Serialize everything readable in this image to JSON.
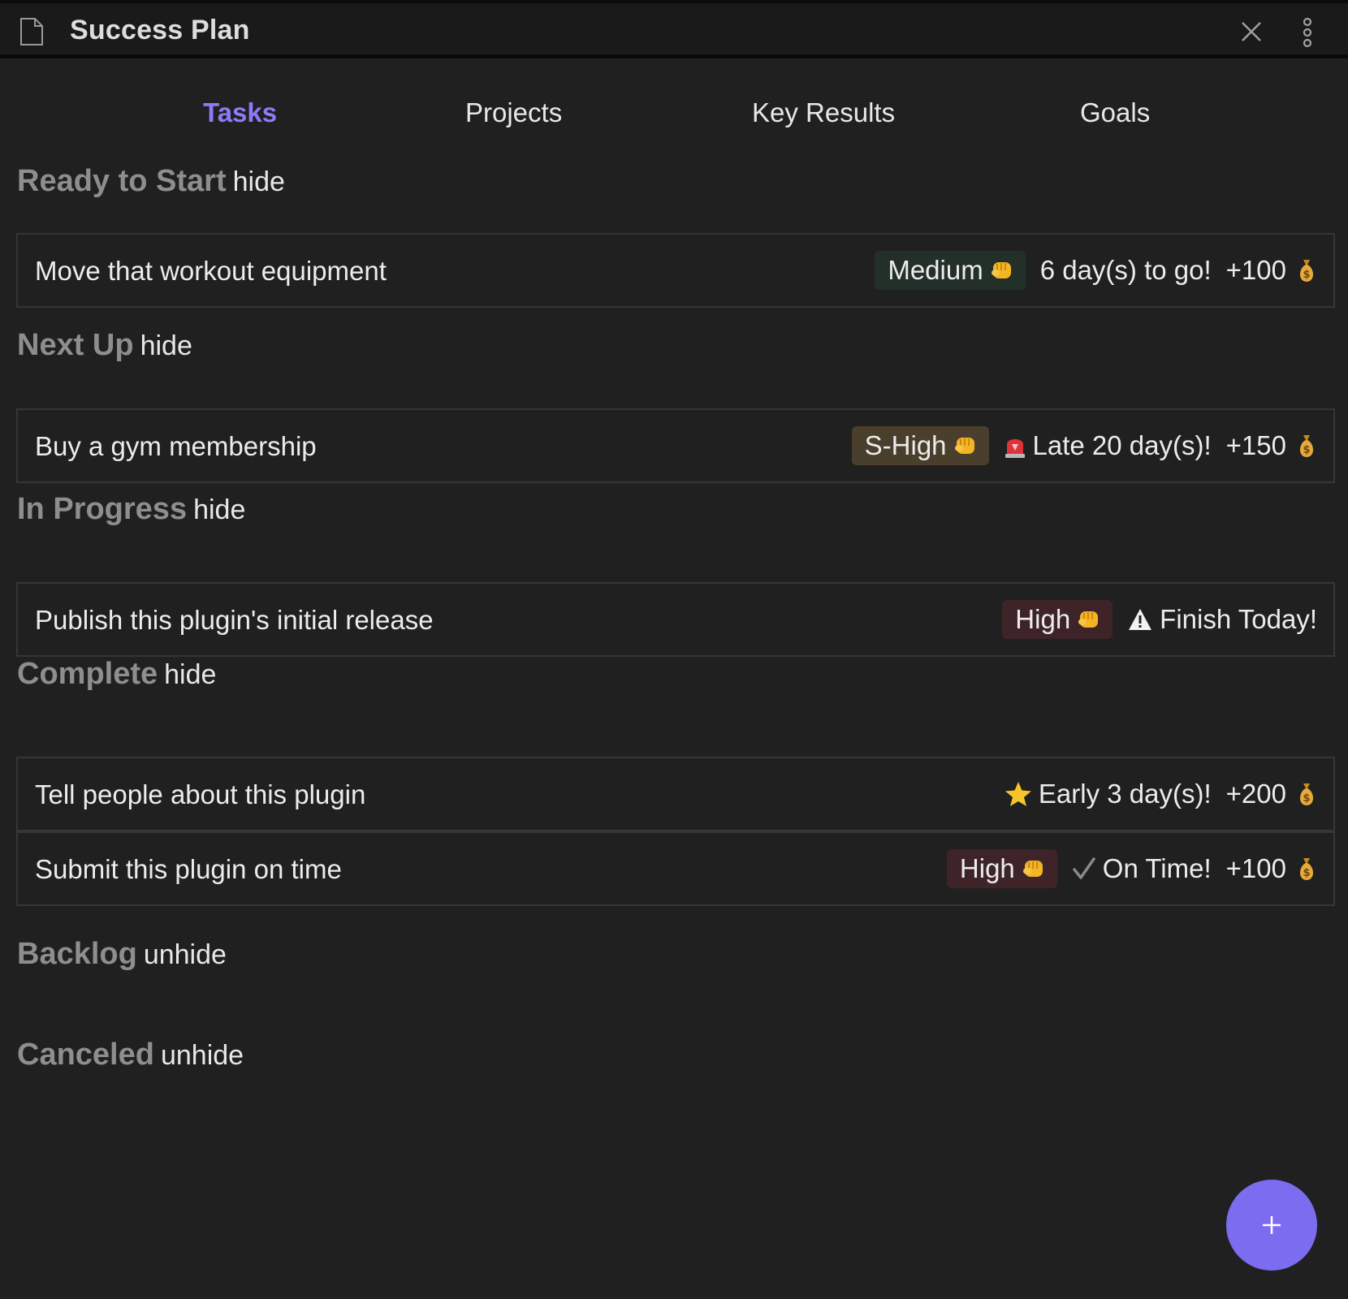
{
  "window": {
    "title": "Success Plan"
  },
  "tabs": [
    {
      "label": "Tasks",
      "active": true
    },
    {
      "label": "Projects",
      "active": false
    },
    {
      "label": "Key Results",
      "active": false
    },
    {
      "label": "Goals",
      "active": false
    }
  ],
  "sections": [
    {
      "title": "Ready to Start",
      "toggle": "hide"
    },
    {
      "title": "Next Up",
      "toggle": "hide"
    },
    {
      "title": "In Progress",
      "toggle": "hide"
    },
    {
      "title": "Complete",
      "toggle": "hide"
    },
    {
      "title": "Backlog",
      "toggle": "unhide"
    },
    {
      "title": "Canceled",
      "toggle": "unhide"
    }
  ],
  "tasks": [
    {
      "name": "Move that workout equipment",
      "priority": "Medium",
      "priority_color": "#23302a",
      "priority_icon": "fist-icon",
      "status": "6 day(s) to go!",
      "status_icon": "",
      "points": "+100",
      "points_icon": "money-bag-icon"
    },
    {
      "name": "Buy a gym membership",
      "priority": "S-High",
      "priority_color": "#4a3f2c",
      "priority_icon": "fist-icon",
      "status": "Late 20 day(s)!",
      "status_icon": "siren-icon",
      "points": "+150",
      "points_icon": "money-bag-icon"
    },
    {
      "name": "Publish this plugin's initial release",
      "priority": "High",
      "priority_color": "#3e2428",
      "priority_icon": "fist-icon",
      "status": "Finish Today!",
      "status_icon": "warning-icon",
      "points": "",
      "points_icon": ""
    },
    {
      "name": "Tell people about this plugin",
      "priority": "",
      "priority_color": "",
      "priority_icon": "",
      "status": "Early 3 day(s)!",
      "status_icon": "star-icon",
      "points": "+200",
      "points_icon": "money-bag-icon"
    },
    {
      "name": "Submit this plugin on time",
      "priority": "High",
      "priority_color": "#3e2428",
      "priority_icon": "fist-icon",
      "status": "On Time!",
      "status_icon": "check-icon",
      "points": "+100",
      "points_icon": "money-bag-icon"
    }
  ],
  "fab": {
    "icon": "plus-icon",
    "color": "#7c6cf0"
  },
  "colors": {
    "accent": "#8b7cf6",
    "background": "#202020"
  }
}
